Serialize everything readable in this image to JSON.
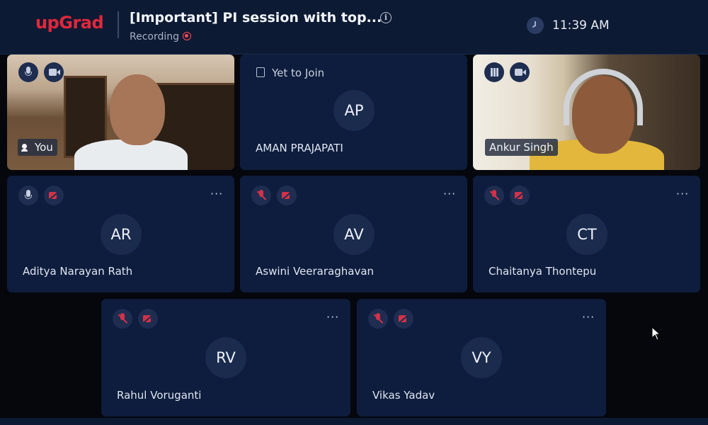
{
  "header": {
    "logo_text": "upGrad",
    "title": "[Important] PI session with top...",
    "recording_label": "Recording",
    "time": "11:39 AM"
  },
  "tiles": {
    "you": {
      "name": "You"
    },
    "aman": {
      "status": "Yet to Join",
      "initials": "AP",
      "name": "AMAN PRAJAPATI"
    },
    "ankur": {
      "name": "Ankur Singh"
    },
    "aditya": {
      "initials": "AR",
      "name": "Aditya Narayan Rath"
    },
    "aswini": {
      "initials": "AV",
      "name": "Aswini Veeraraghavan"
    },
    "chaitanya": {
      "initials": "CT",
      "name": "Chaitanya Thontepu"
    },
    "rahul": {
      "initials": "RV",
      "name": "Rahul Voruganti"
    },
    "vikas": {
      "initials": "VY",
      "name": "Vikas Yadav"
    }
  },
  "more_label": "···",
  "colors": {
    "brand": "#e0283c",
    "tile_bg": "#0e1d3d",
    "muted_red": "#d2324a",
    "recording_red": "#ff4a57"
  }
}
